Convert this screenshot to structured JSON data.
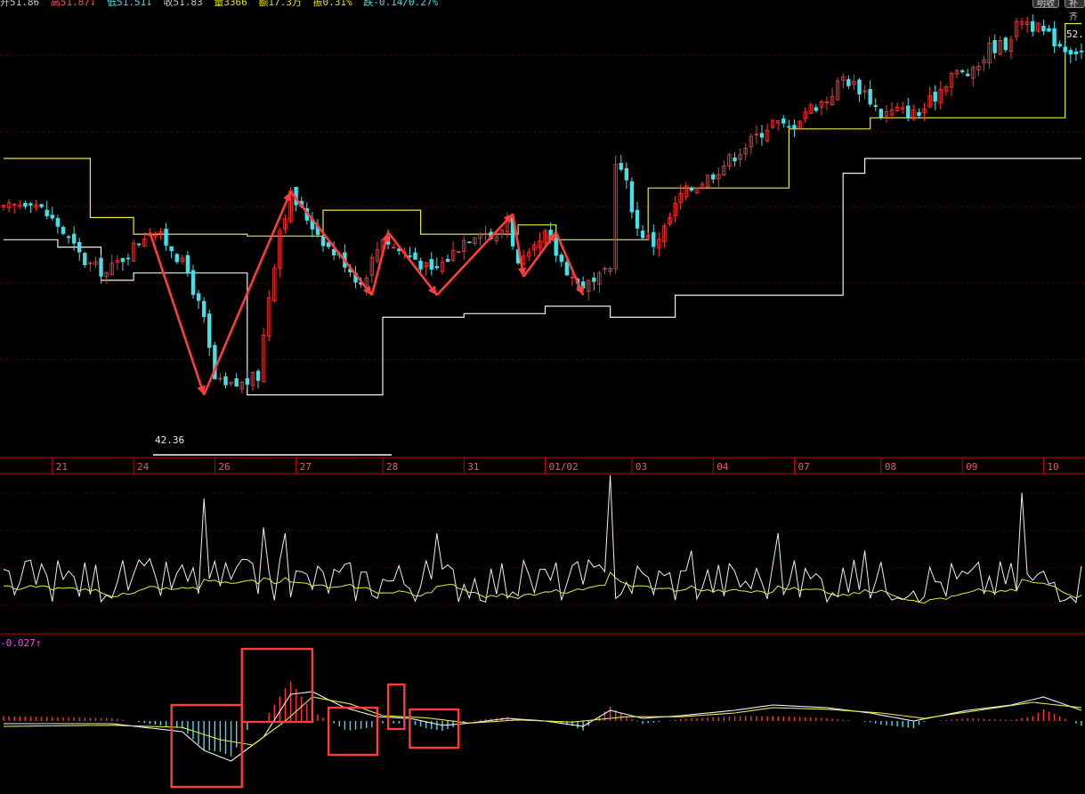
{
  "header": {
    "open": "开51.86",
    "high": "高51.87↓",
    "low": "低51.51↓",
    "close": "收51.83",
    "volume": "量3366",
    "amount": "额17.3万",
    "amplitude": "振0.31%",
    "change": "跌-0.14/0.27%",
    "btn1": "明收",
    "btn2": "补齐"
  },
  "labels": {
    "low_price": "42.36",
    "high_price": "52.",
    "macd_value": "-0.027↑"
  },
  "colors": {
    "background": "#000000",
    "up": "#ff3333",
    "down": "#44e0e8",
    "channel_upper": "#e8e840",
    "channel_lower": "#f0f0f0",
    "divider": "#cc0000",
    "annotation": "#ff3b3b",
    "macd_label": "#ff40ff"
  },
  "chart_data": {
    "type": "candlestick",
    "price_axis": {
      "min": 41.0,
      "max": 53.0
    },
    "x_axis": {
      "ticks": [
        {
          "label": "21",
          "idx": 9
        },
        {
          "label": "24",
          "idx": 24
        },
        {
          "label": "26",
          "idx": 39
        },
        {
          "label": "27",
          "idx": 54
        },
        {
          "label": "28",
          "idx": 70
        },
        {
          "label": "31",
          "idx": 85
        },
        {
          "label": "01/02",
          "idx": 100
        },
        {
          "label": "03",
          "idx": 116
        },
        {
          "label": "04",
          "idx": 131
        },
        {
          "label": "07",
          "idx": 146
        },
        {
          "label": "08",
          "idx": 162
        },
        {
          "label": "09",
          "idx": 177
        },
        {
          "label": "10",
          "idx": 192
        }
      ],
      "bar_count": 200
    },
    "close_anchors": [
      [
        0,
        47.6
      ],
      [
        5,
        47.9
      ],
      [
        10,
        47.2
      ],
      [
        15,
        46.2
      ],
      [
        19,
        45.9
      ],
      [
        24,
        46.6
      ],
      [
        27,
        47.1
      ],
      [
        31,
        46.6
      ],
      [
        34,
        45.9
      ],
      [
        37,
        44.6
      ],
      [
        39,
        43.0
      ],
      [
        41,
        42.8
      ],
      [
        44,
        42.9
      ],
      [
        47,
        43.1
      ],
      [
        49,
        45.3
      ],
      [
        51,
        47.1
      ],
      [
        53,
        48.0
      ],
      [
        56,
        47.4
      ],
      [
        60,
        46.6
      ],
      [
        63,
        46.2
      ],
      [
        66,
        45.6
      ],
      [
        70,
        46.9
      ],
      [
        72,
        46.6
      ],
      [
        76,
        46.3
      ],
      [
        79,
        45.9
      ],
      [
        82,
        46.3
      ],
      [
        85,
        46.8
      ],
      [
        88,
        47.1
      ],
      [
        91,
        46.8
      ],
      [
        93,
        47.4
      ],
      [
        95,
        46.1
      ],
      [
        97,
        46.3
      ],
      [
        100,
        46.9
      ],
      [
        103,
        46.2
      ],
      [
        106,
        45.6
      ],
      [
        109,
        45.6
      ],
      [
        112,
        46.0
      ],
      [
        113,
        49.0
      ],
      [
        115,
        48.3
      ],
      [
        117,
        47.1
      ],
      [
        120,
        46.7
      ],
      [
        122,
        47.1
      ],
      [
        125,
        48.0
      ],
      [
        128,
        48.3
      ],
      [
        131,
        48.6
      ],
      [
        135,
        49.1
      ],
      [
        139,
        49.6
      ],
      [
        142,
        50.0
      ],
      [
        145,
        49.8
      ],
      [
        148,
        50.3
      ],
      [
        152,
        50.6
      ],
      [
        155,
        51.2
      ],
      [
        159,
        50.8
      ],
      [
        162,
        50.2
      ],
      [
        165,
        50.3
      ],
      [
        169,
        50.2
      ],
      [
        172,
        50.7
      ],
      [
        175,
        51.3
      ],
      [
        179,
        51.3
      ],
      [
        182,
        52.0
      ],
      [
        185,
        52.1
      ],
      [
        188,
        52.8
      ],
      [
        190,
        52.6
      ],
      [
        193,
        52.3
      ],
      [
        196,
        52.0
      ],
      [
        199,
        51.9
      ]
    ],
    "upper_channel": [
      [
        0,
        49.0
      ],
      [
        16,
        49.0
      ],
      [
        16,
        47.4
      ],
      [
        24,
        47.4
      ],
      [
        24,
        46.95
      ],
      [
        45,
        46.95
      ],
      [
        45,
        46.9
      ],
      [
        59,
        46.9
      ],
      [
        59,
        47.6
      ],
      [
        77,
        47.6
      ],
      [
        77,
        46.95
      ],
      [
        95,
        46.95
      ],
      [
        95,
        47.2
      ],
      [
        102,
        47.2
      ],
      [
        102,
        46.8
      ],
      [
        119,
        46.8
      ],
      [
        119,
        48.2
      ],
      [
        145,
        48.2
      ],
      [
        145,
        49.8
      ],
      [
        160,
        49.8
      ],
      [
        160,
        50.1
      ],
      [
        196,
        50.1
      ],
      [
        196,
        52.65
      ],
      [
        199,
        52.65
      ]
    ],
    "lower_channel": [
      [
        0,
        46.8
      ],
      [
        10,
        46.8
      ],
      [
        10,
        46.6
      ],
      [
        18,
        46.6
      ],
      [
        18,
        45.7
      ],
      [
        24,
        45.7
      ],
      [
        24,
        45.9
      ],
      [
        45,
        45.9
      ],
      [
        45,
        42.6
      ],
      [
        70,
        42.6
      ],
      [
        70,
        44.7
      ],
      [
        85,
        44.7
      ],
      [
        85,
        44.8
      ],
      [
        100,
        44.8
      ],
      [
        100,
        45.0
      ],
      [
        112,
        45.0
      ],
      [
        112,
        44.7
      ],
      [
        124,
        44.7
      ],
      [
        124,
        45.3
      ],
      [
        155,
        45.3
      ],
      [
        155,
        48.6
      ],
      [
        159,
        48.6
      ],
      [
        159,
        49.0
      ],
      [
        199,
        49.0
      ]
    ],
    "annotation_path": [
      [
        27,
        47.0
      ],
      [
        37,
        42.6
      ],
      [
        53,
        48.1
      ],
      [
        68,
        45.3
      ],
      [
        71,
        47.0
      ],
      [
        80,
        45.3
      ],
      [
        94,
        47.5
      ],
      [
        96,
        45.8
      ],
      [
        102,
        47.0
      ],
      [
        107,
        45.3
      ]
    ],
    "volume_indicator": {
      "spikes": [
        [
          37,
          1.0
        ],
        [
          48,
          0.75
        ],
        [
          52,
          0.7
        ],
        [
          80,
          0.7
        ],
        [
          112,
          1.2
        ],
        [
          127,
          0.55
        ],
        [
          143,
          0.7
        ],
        [
          159,
          0.55
        ],
        [
          188,
          1.05
        ]
      ]
    },
    "macd": {
      "current_label": "-0.027↑",
      "dif_anchors": [
        [
          0,
          -0.05
        ],
        [
          20,
          -0.05
        ],
        [
          33,
          -0.2
        ],
        [
          37,
          -0.55
        ],
        [
          42,
          -0.75
        ],
        [
          48,
          -0.3
        ],
        [
          53,
          0.5
        ],
        [
          57,
          0.55
        ],
        [
          63,
          0.25
        ],
        [
          69,
          0.08
        ],
        [
          75,
          0.05
        ],
        [
          81,
          -0.08
        ],
        [
          85,
          -0.05
        ],
        [
          93,
          0.05
        ],
        [
          100,
          0.0
        ],
        [
          107,
          -0.1
        ],
        [
          112,
          0.2
        ],
        [
          118,
          0.05
        ],
        [
          125,
          0.1
        ],
        [
          135,
          0.2
        ],
        [
          142,
          0.3
        ],
        [
          152,
          0.25
        ],
        [
          160,
          0.15
        ],
        [
          168,
          0.0
        ],
        [
          178,
          0.2
        ],
        [
          186,
          0.3
        ],
        [
          192,
          0.45
        ],
        [
          199,
          0.2
        ]
      ],
      "dea_anchors": [
        [
          0,
          -0.1
        ],
        [
          20,
          -0.08
        ],
        [
          33,
          -0.12
        ],
        [
          40,
          -0.35
        ],
        [
          46,
          -0.45
        ],
        [
          52,
          0.0
        ],
        [
          57,
          0.45
        ],
        [
          64,
          0.32
        ],
        [
          70,
          0.1
        ],
        [
          78,
          0.06
        ],
        [
          86,
          -0.04
        ],
        [
          95,
          0.02
        ],
        [
          105,
          -0.02
        ],
        [
          115,
          0.08
        ],
        [
          125,
          0.08
        ],
        [
          135,
          0.15
        ],
        [
          142,
          0.25
        ],
        [
          152,
          0.22
        ],
        [
          162,
          0.15
        ],
        [
          170,
          0.05
        ],
        [
          180,
          0.2
        ],
        [
          190,
          0.35
        ],
        [
          199,
          0.25
        ]
      ]
    }
  }
}
